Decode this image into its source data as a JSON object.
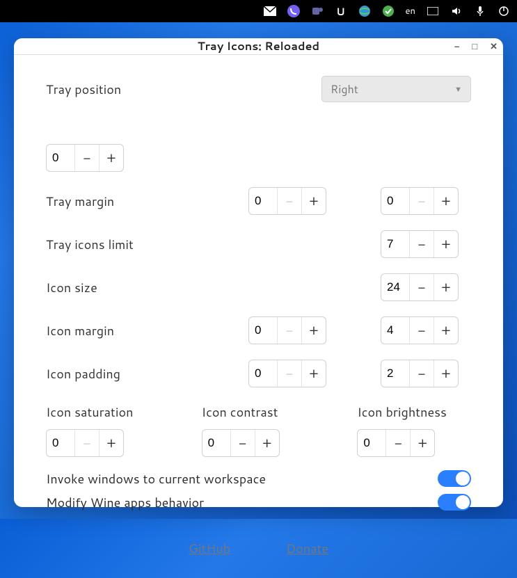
{
  "topbar": {
    "lang": "en"
  },
  "window": {
    "title": "Tray Icons: Reloaded"
  },
  "settings": {
    "tray_position": {
      "label": "Tray position",
      "value": "Right",
      "offset": "0"
    },
    "tray_margin": {
      "label": "Tray margin",
      "left": "0",
      "right": "0"
    },
    "icons_limit": {
      "label": "Tray icons limit",
      "value": "7"
    },
    "icon_size": {
      "label": "Icon size",
      "value": "24"
    },
    "icon_margin": {
      "label": "Icon margin",
      "left": "0",
      "right": "4"
    },
    "icon_padding": {
      "label": "Icon padding",
      "left": "0",
      "right": "2"
    },
    "saturation": {
      "label": "Icon saturation",
      "value": "0"
    },
    "contrast": {
      "label": "Icon contrast",
      "value": "0"
    },
    "brightness": {
      "label": "Icon brightness",
      "value": "0"
    },
    "invoke": {
      "label": "Invoke windows to current workspace"
    },
    "wine": {
      "label": "Modify Wine apps behavior"
    }
  },
  "footer": {
    "github": "GitHub",
    "donate": "Donate"
  }
}
